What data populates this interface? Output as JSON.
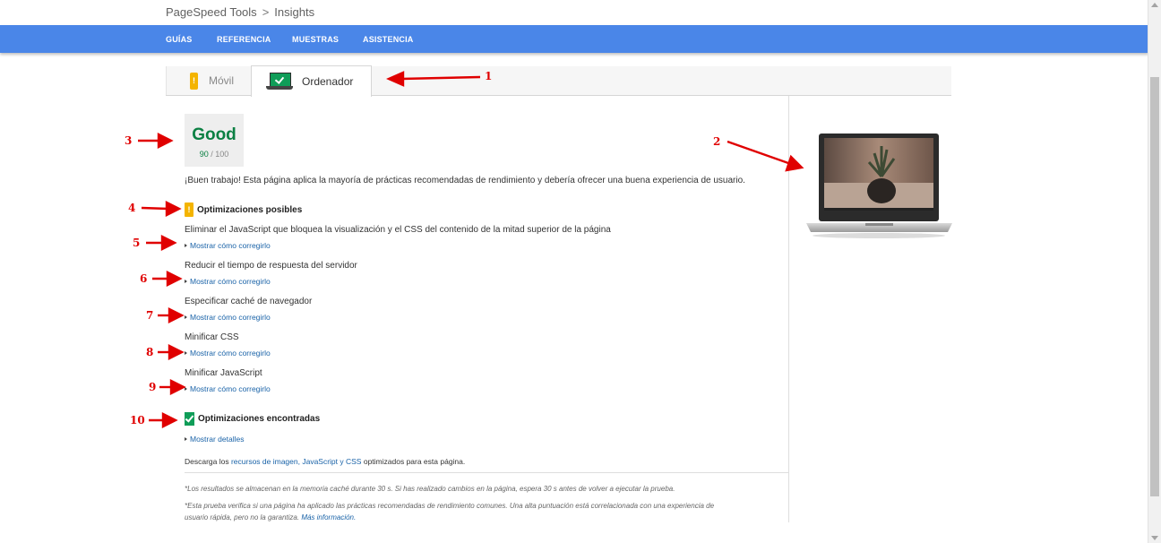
{
  "header": {
    "breadcrumb_root": "PageSpeed Tools",
    "breadcrumb_current": "Insights",
    "nav": [
      "GUÍAS",
      "REFERENCIA",
      "MUESTRAS",
      "ASISTENCIA"
    ]
  },
  "tabs": {
    "movil": "Móvil",
    "ordenador": "Ordenador"
  },
  "score": {
    "label": "Good",
    "value": "90",
    "max": "/ 100"
  },
  "summary": "¡Buen trabajo! Esta página aplica la mayoría de prácticas recomendadas de rendimiento y debería ofrecer una buena experiencia de usuario.",
  "possible": {
    "title": "Optimizaciones posibles",
    "rules": [
      {
        "title": "Eliminar el JavaScript que bloquea la visualización y el CSS del contenido de la mitad superior de la página",
        "link": "Mostrar cómo corregirlo"
      },
      {
        "title": "Reducir el tiempo de respuesta del servidor",
        "link": "Mostrar cómo corregirlo"
      },
      {
        "title": "Especificar caché de navegador",
        "link": "Mostrar cómo corregirlo"
      },
      {
        "title": "Minificar CSS",
        "link": "Mostrar cómo corregirlo"
      },
      {
        "title": "Minificar JavaScript",
        "link": "Mostrar cómo corregirlo"
      }
    ]
  },
  "found": {
    "title": "Optimizaciones encontradas",
    "link": "Mostrar detalles"
  },
  "download": {
    "prefix": "Descarga los ",
    "link": "recursos de imagen, JavaScript y CSS",
    "suffix": " optimizados para esta página."
  },
  "notes": {
    "cache": "*Los resultados se almacenan en la memoria caché durante 30 s. Si has realizado cambios en la página, espera 30 s antes de volver a ejecutar la prueba.",
    "check_line1": "*Esta prueba verifica si una página ha aplicado las prácticas recomendadas de rendimiento comunes. Una alta puntuación está correlacionada con una experiencia de",
    "check_line2": "usuario rápida, pero no la garantiza. ",
    "more_link": "Más información."
  },
  "annotations": [
    "1",
    "2",
    "3",
    "4",
    "5",
    "6",
    "7",
    "8",
    "9",
    "10"
  ],
  "colors": {
    "nav_blue": "#4a86e8",
    "good_green": "#0b8043",
    "warning": "#f4b400",
    "link": "#1a63a8",
    "annotation_red": "#e00000"
  }
}
